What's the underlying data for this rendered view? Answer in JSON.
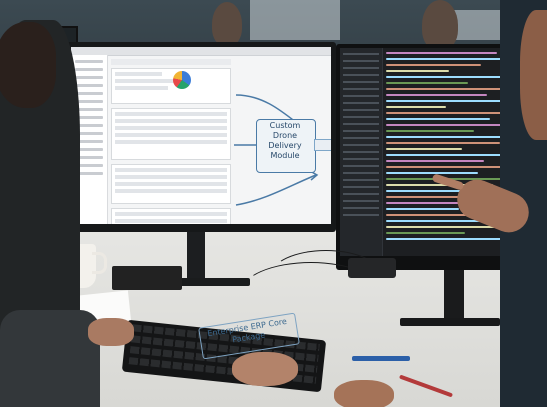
{
  "scene": {
    "description_labels": {
      "screen_module_label": "Custom Drone Delivery Module",
      "desk_label": "Enterprise ERP Core Package"
    }
  },
  "colors": {
    "sketch_blue": "#4a7aa6",
    "code_keyword": "#c586c0",
    "code_string": "#ce9178",
    "code_func": "#dcdcaa",
    "code_var": "#9cdcfe",
    "code_green": "#6a9955"
  },
  "icons": [
    "pie-chart-icon",
    "arrow-icon",
    "connector-plug-icon"
  ]
}
